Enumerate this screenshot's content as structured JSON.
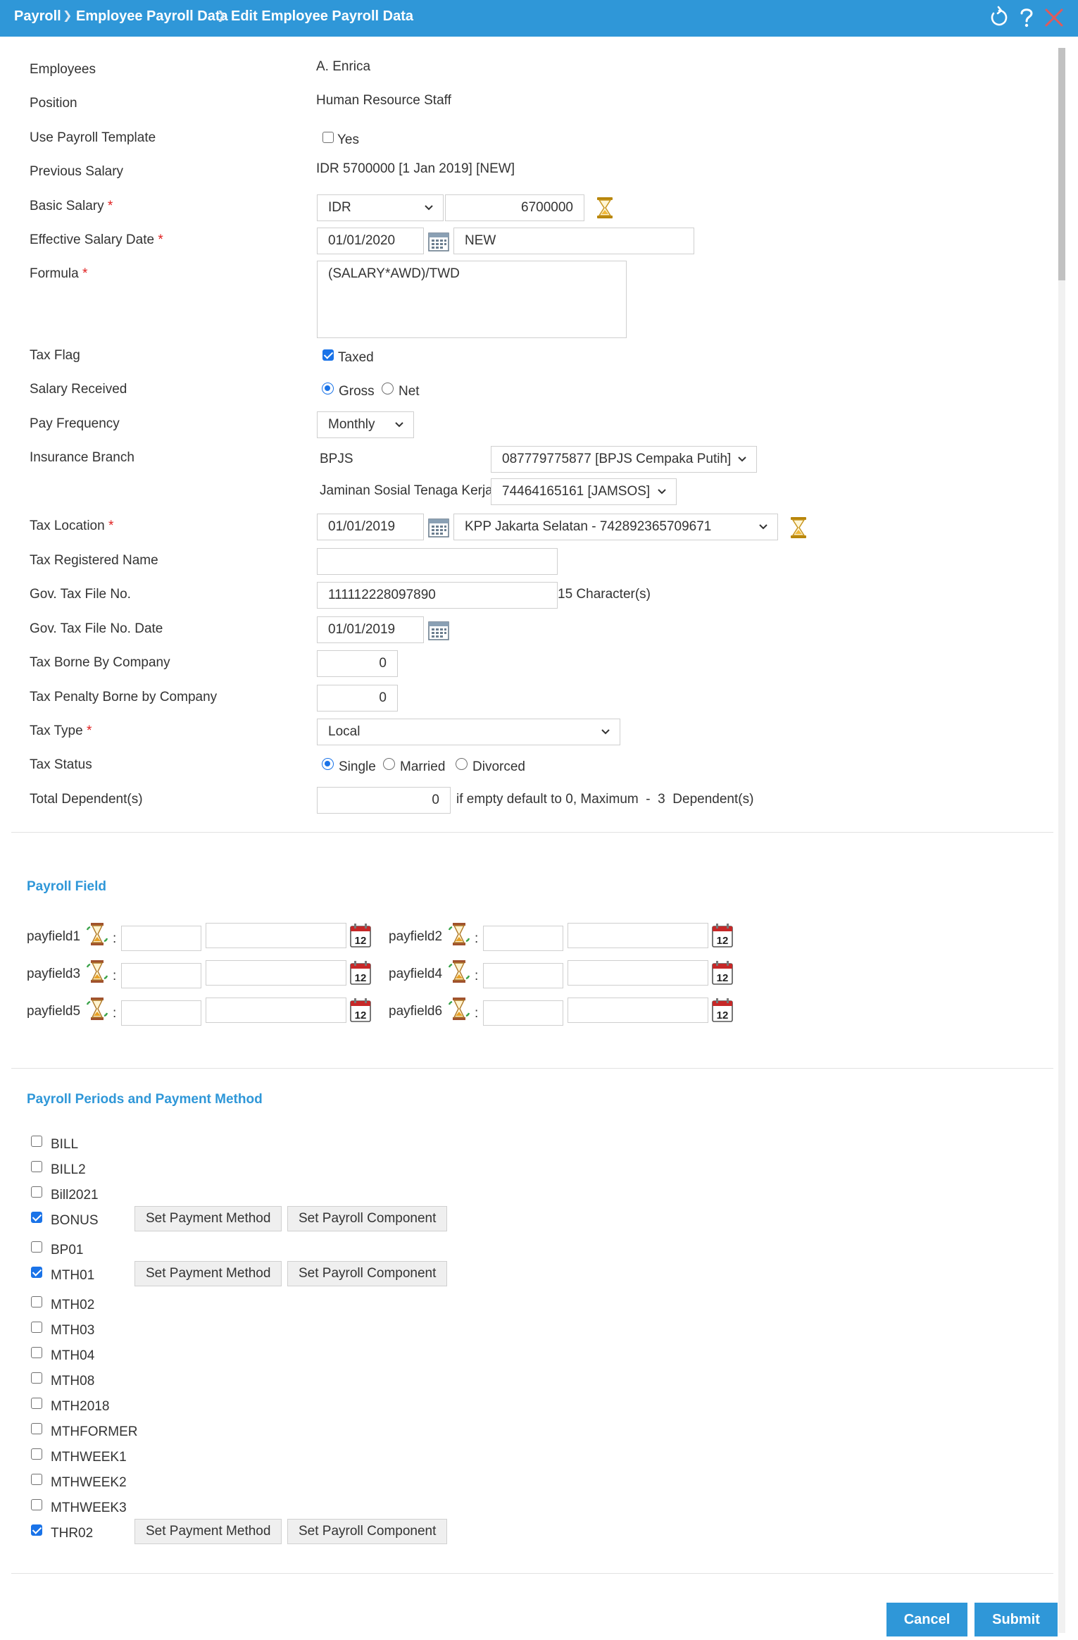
{
  "header": {
    "breadcrumb": [
      "Payroll",
      "Employee Payroll Data",
      "Edit Employee Payroll Data"
    ],
    "icons": [
      "refresh-icon",
      "help-icon",
      "close-icon"
    ]
  },
  "form": {
    "employees_label": "Employees",
    "employees_value": "A. Enrica",
    "position_label": "Position",
    "position_value": "Human Resource Staff",
    "use_template_label": "Use Payroll Template",
    "use_template_option": "Yes",
    "use_template_checked": false,
    "previous_salary_label": "Previous Salary",
    "previous_salary_value": "IDR 5700000 [1 Jan 2019] [NEW]",
    "basic_salary_label": "Basic Salary",
    "required_mark": "*",
    "currency_selected": "IDR",
    "basic_salary_value": "6700000",
    "effective_date_label": "Effective Salary Date",
    "effective_date_value": "01/01/2020",
    "effective_date_note": "NEW",
    "formula_label": "Formula",
    "formula_value": "(SALARY*AWD)/TWD",
    "tax_flag_label": "Tax Flag",
    "tax_flag_option": "Taxed",
    "tax_flag_checked": true,
    "salary_received_label": "Salary Received",
    "salary_received_options": [
      "Gross",
      "Net"
    ],
    "salary_received_selected": "Gross",
    "pay_frequency_label": "Pay Frequency",
    "pay_frequency_selected": "Monthly",
    "insurance_branch_label": "Insurance Branch",
    "bpjs_label": "BPJS",
    "bpjs_selected": "087779775877 [BPJS Cempaka Putih]",
    "jamsos_label": "Jaminan Sosial Tenaga Kerja",
    "jamsos_selected": "74464165161 [JAMSOS]",
    "tax_location_label": "Tax Location",
    "tax_location_date": "01/01/2019",
    "tax_location_selected": "KPP Jakarta Selatan - 742892365709671",
    "tax_registered_name_label": "Tax Registered Name",
    "tax_registered_name_value": "",
    "gov_tax_file_label": "Gov. Tax File No.",
    "gov_tax_file_value": "111112228097890",
    "gov_tax_file_note": "15 Character(s)",
    "gov_tax_file_date_label": "Gov. Tax File No. Date",
    "gov_tax_file_date_value": "01/01/2019",
    "tax_borne_label": "Tax Borne By Company",
    "tax_borne_value": "0",
    "tax_penalty_label": "Tax Penalty Borne by Company",
    "tax_penalty_value": "0",
    "tax_type_label": "Tax Type",
    "tax_type_selected": "Local",
    "tax_status_label": "Tax Status",
    "tax_status_options": [
      "Single",
      "Married",
      "Divorced"
    ],
    "tax_status_selected": "Single",
    "total_dependents_label": "Total Dependent(s)",
    "total_dependents_value": "0",
    "total_dependents_note": "if empty default to 0, Maximum  -  3  Dependent(s)"
  },
  "payroll_field": {
    "title": "Payroll Field",
    "colon": ":",
    "fields": [
      "payfield1",
      "payfield2",
      "payfield3",
      "payfield4",
      "payfield5",
      "payfield6"
    ]
  },
  "periods": {
    "title": "Payroll Periods and Payment Method",
    "set_payment_label": "Set Payment Method",
    "set_component_label": "Set Payroll Component",
    "items": [
      {
        "code": "BILL",
        "checked": false
      },
      {
        "code": "BILL2",
        "checked": false
      },
      {
        "code": "Bill2021",
        "checked": false
      },
      {
        "code": "BONUS",
        "checked": true
      },
      {
        "code": "BP01",
        "checked": false
      },
      {
        "code": "MTH01",
        "checked": true
      },
      {
        "code": "MTH02",
        "checked": false
      },
      {
        "code": "MTH03",
        "checked": false
      },
      {
        "code": "MTH04",
        "checked": false
      },
      {
        "code": "MTH08",
        "checked": false
      },
      {
        "code": "MTH2018",
        "checked": false
      },
      {
        "code": "MTHFORMER",
        "checked": false
      },
      {
        "code": "MTHWEEK1",
        "checked": false
      },
      {
        "code": "MTHWEEK2",
        "checked": false
      },
      {
        "code": "MTHWEEK3",
        "checked": false
      },
      {
        "code": "THR02",
        "checked": true
      }
    ]
  },
  "actions": {
    "cancel_label": "Cancel",
    "submit_label": "Submit"
  },
  "colors": {
    "header_bg": "#2f97d8",
    "accent": "#2f97d8",
    "required": "#e02020",
    "checkbox": "#1a73e8"
  }
}
